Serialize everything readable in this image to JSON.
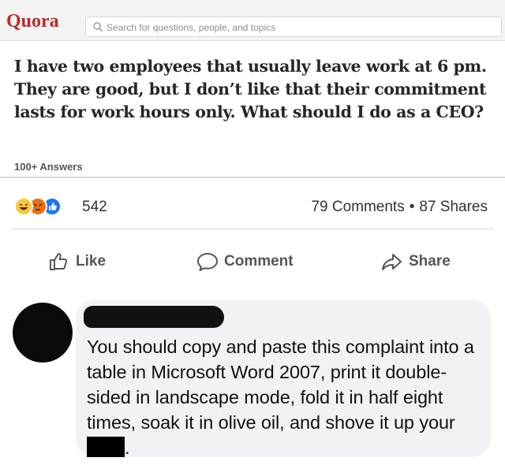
{
  "quora": {
    "logo": "Quora",
    "search_placeholder": "Search for questions, people, and topics",
    "question": "I have two employees that usually leave work at 6 pm. They are good, but I don’t like that their commitment lasts for work hours only. What should I do as a CEO?",
    "answers_count": "100+ Answers"
  },
  "post": {
    "reactions": [
      "haha",
      "angry",
      "like"
    ],
    "reaction_count": "542",
    "comments": "79 Comments",
    "separator": "•",
    "shares": "87 Shares"
  },
  "actions": {
    "like": "Like",
    "comment": "Comment",
    "share": "Share"
  },
  "comment": {
    "text_before": "You should copy and paste this complaint into a table in Microsoft Word 2007, print it double-sided in landscape mode, fold it in half eight times, soak it in olive oil, and shove it up your ",
    "text_after": "."
  },
  "colors": {
    "quora_red": "#b92b27",
    "bubble_bg": "#f0f2f5",
    "like_blue": "#1877f2"
  }
}
